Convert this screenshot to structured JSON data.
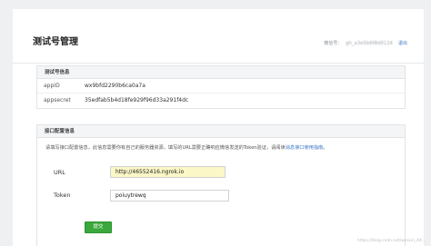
{
  "header": {
    "title": "测试号管理",
    "account_label": "微信号：",
    "account_value": "gh_a3e5b6f8d0124",
    "logout": "退出"
  },
  "test_info": {
    "heading": "测试号信息",
    "rows": [
      {
        "key": "appID",
        "value": "wx9bfd2290b6ca0a7a"
      },
      {
        "key": "appsecret",
        "value": "35edfab5b4d18fe929f96d33a291f4dc"
      }
    ]
  },
  "interface": {
    "heading": "接口配置信息",
    "intro_text": "请填写接口配置信息，此信息需要你有自己的服务器资源，填写的URL需要正确响应微信发送的Token验证，请阅读",
    "intro_link": "消息接口使用指南",
    "intro_end": "。",
    "url_label": "URL",
    "url_value": "http://46552416.ngrok.io",
    "token_label": "Token",
    "token_value": "poiuytrewq",
    "submit_label": "提交"
  },
  "watermark": "https://blog.csdn.net/weixin_44..."
}
